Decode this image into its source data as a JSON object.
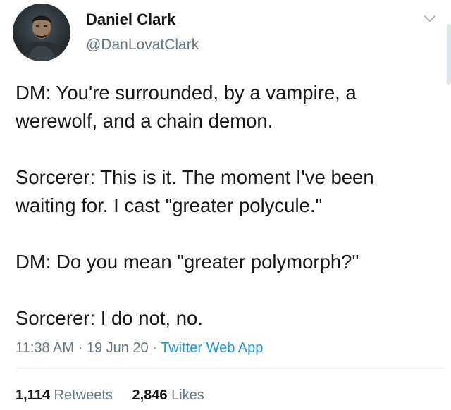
{
  "user": {
    "display_name": "Daniel Clark",
    "handle": "@DanLovatClark",
    "avatar_icon": "profile-photo"
  },
  "tweet": {
    "paragraphs": [
      "DM: You're surrounded, by a vampire, a werewolf, and a chain demon.",
      "Sorcerer: This is it. The moment I've been waiting for. I cast \"greater polycule.\"",
      "DM: Do you mean \"greater polymorph?\"",
      "Sorcerer: I do not, no."
    ],
    "time": "11:38 AM",
    "date": "19 Jun 20",
    "separator": "·",
    "source": "Twitter Web App"
  },
  "stats": {
    "retweets_count": "1,114",
    "retweets_label": "Retweets",
    "likes_count": "2,846",
    "likes_label": "Likes"
  },
  "colors": {
    "text": "#14171a",
    "secondary": "#66757f",
    "link": "#1b95e0",
    "divider": "#e1e8ed"
  }
}
